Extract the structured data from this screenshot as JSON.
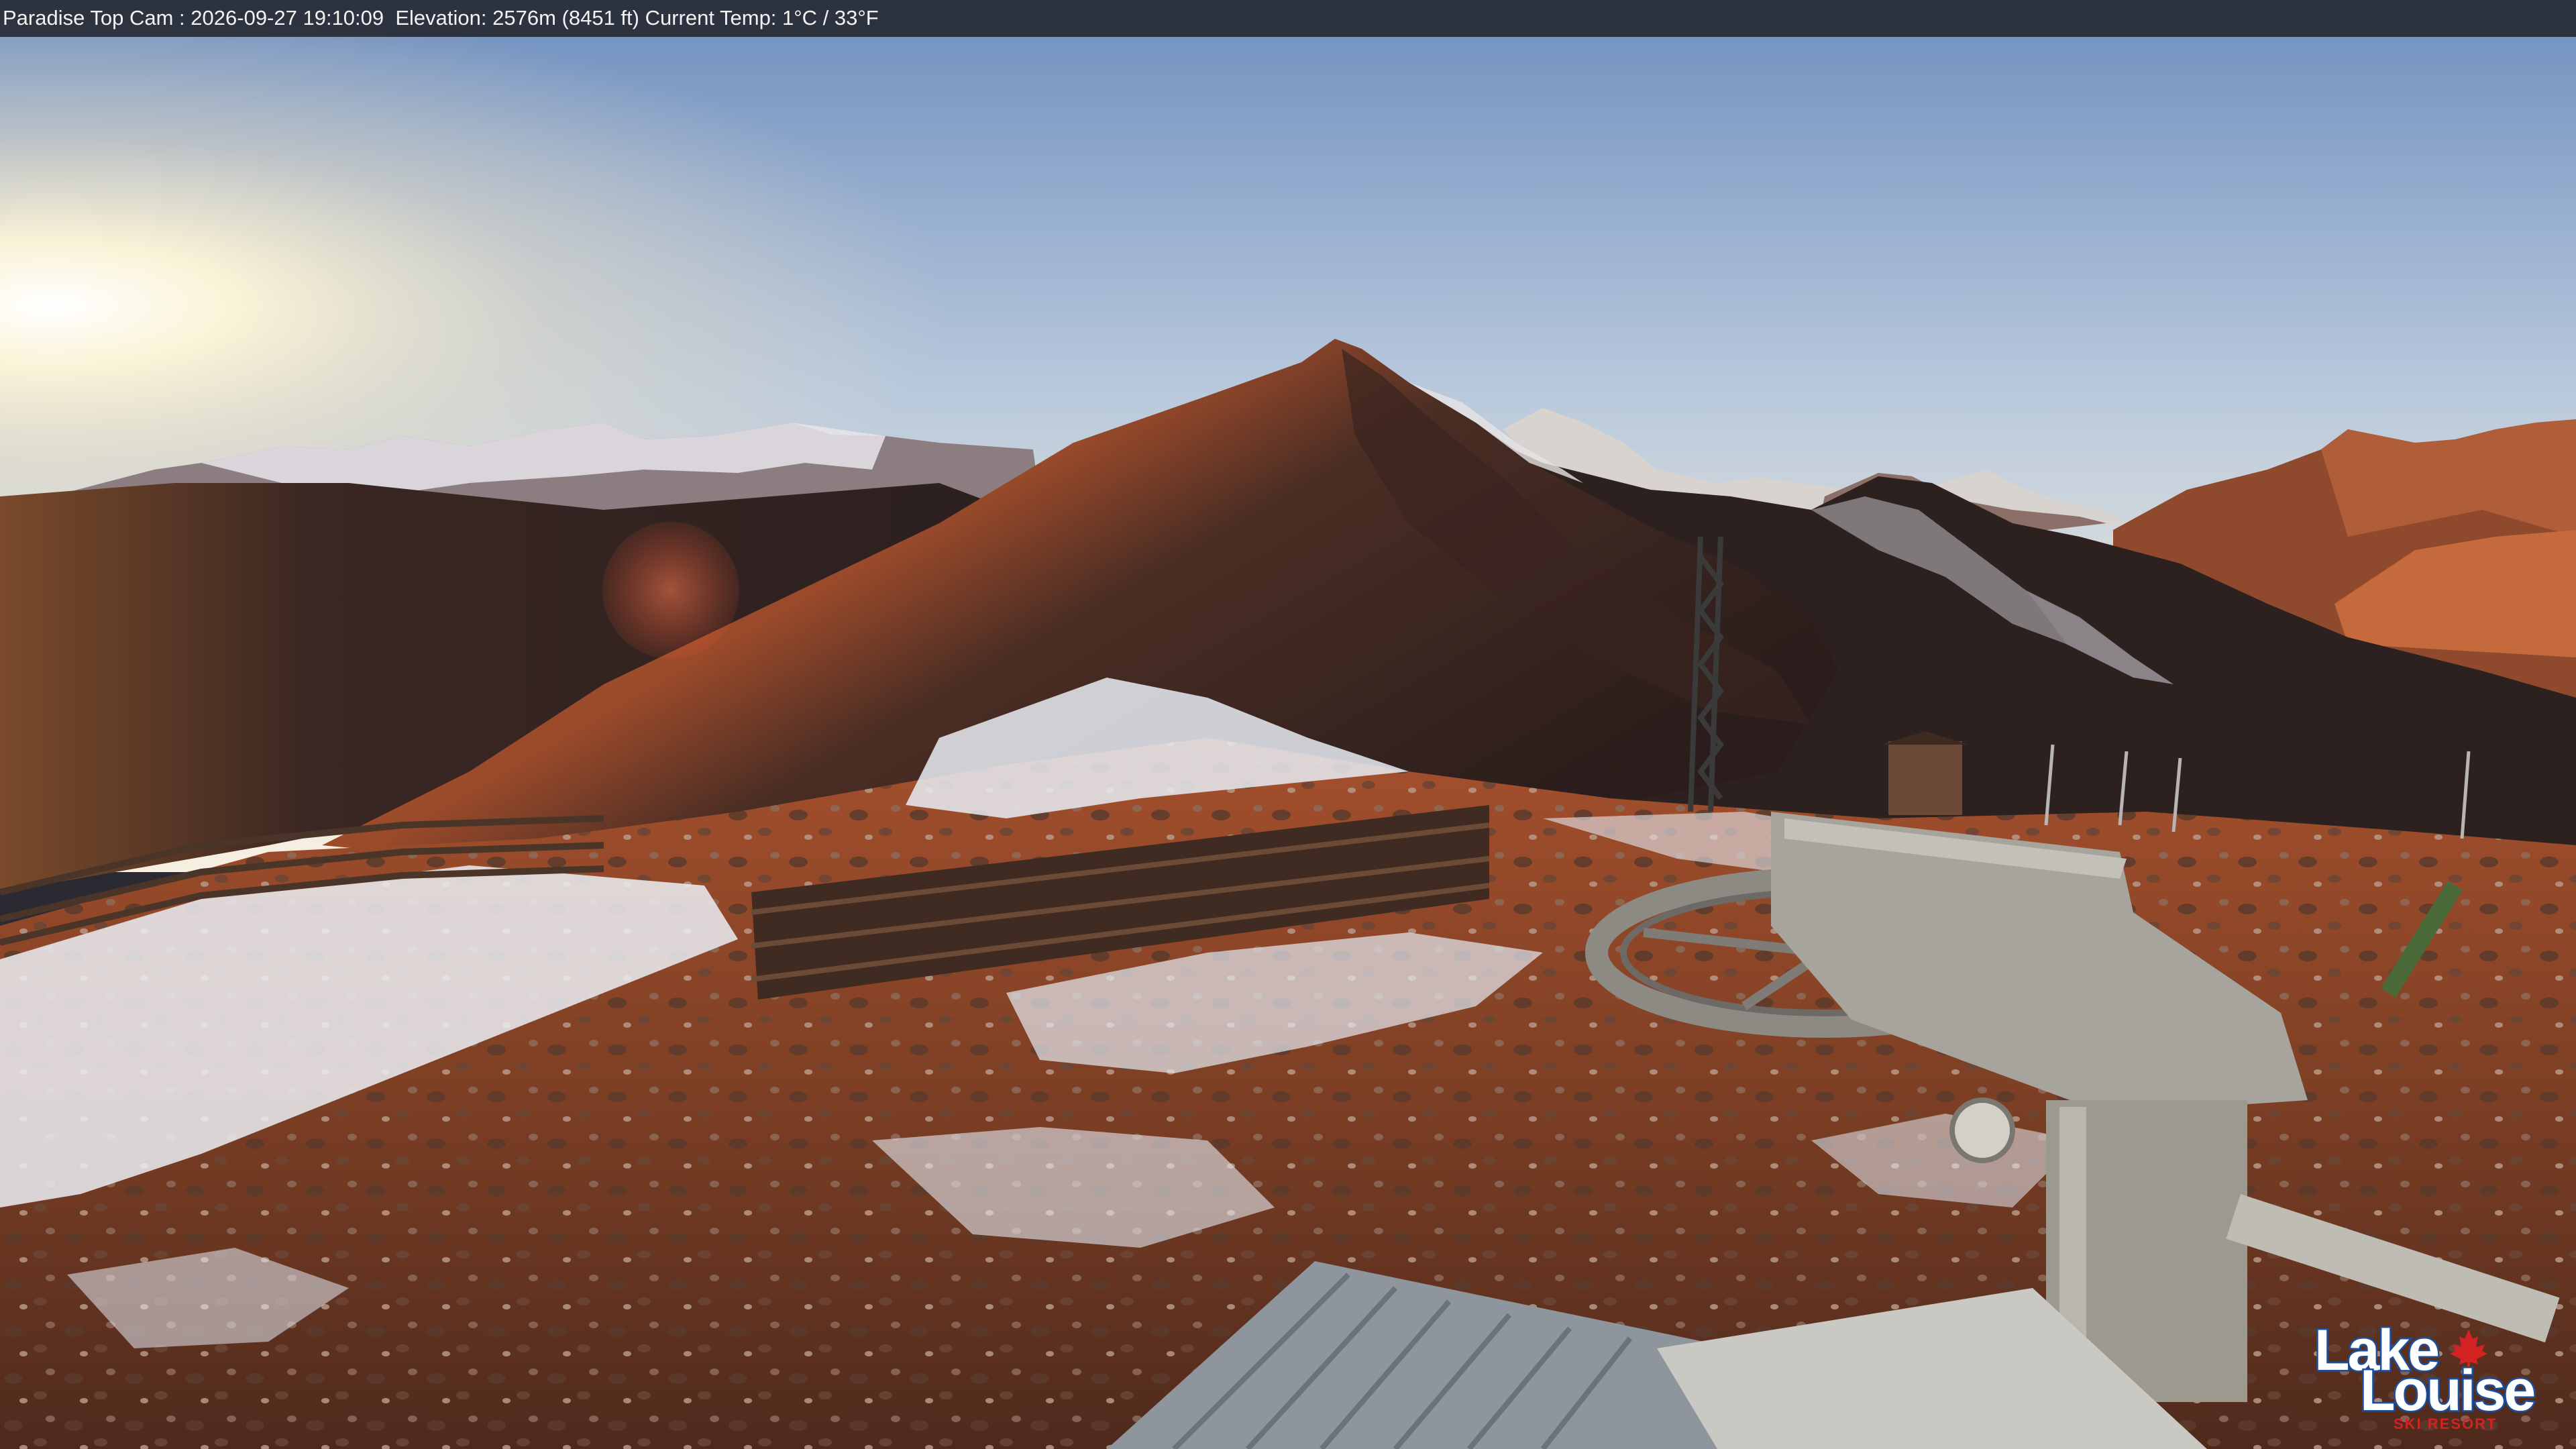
{
  "overlay": {
    "camera_info": "Paradise Top Cam : 2026-09-27 19:10:09  Elevation: 2576m (8451 ft) Current Temp: 1°C / 33°F"
  },
  "logo": {
    "line1": "Lake",
    "line2": "Louise",
    "tagline": "SKI RESORT"
  },
  "colors": {
    "sky_top": "#7f9cc3",
    "sky_horizon": "#f4efe4",
    "sun": "#fffbe8",
    "alpenglow": "#b8542a",
    "shadow_mountain": "#2e1e1a",
    "snow": "#e9ecf2",
    "logo_blue": "#1a4fa0",
    "logo_red": "#d32222"
  }
}
